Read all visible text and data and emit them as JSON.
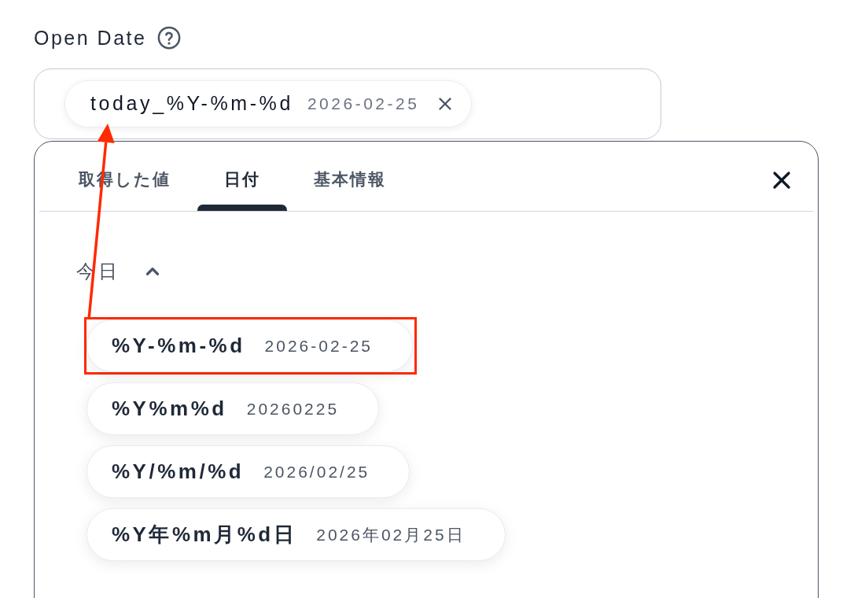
{
  "field": {
    "label": "Open Date",
    "chips": [
      {
        "label": "today_%Y-%m-%d",
        "value": "2026-02-25"
      }
    ]
  },
  "picker": {
    "tabs": [
      {
        "label": "取得した値",
        "selected": false
      },
      {
        "label": "日付",
        "selected": true
      },
      {
        "label": "基本情報",
        "selected": false
      }
    ],
    "sections": [
      {
        "title": "今日",
        "expanded": true,
        "items": [
          {
            "pattern": "%Y-%m-%d",
            "example": "2026-02-25",
            "highlighted": true
          },
          {
            "pattern": "%Y%m%d",
            "example": "20260225",
            "highlighted": false
          },
          {
            "pattern": "%Y/%m/%d",
            "example": "2026/02/25",
            "highlighted": false
          },
          {
            "pattern": "%Y年%m月%d日",
            "example": "2026年02月25日",
            "highlighted": false
          }
        ]
      }
    ]
  }
}
